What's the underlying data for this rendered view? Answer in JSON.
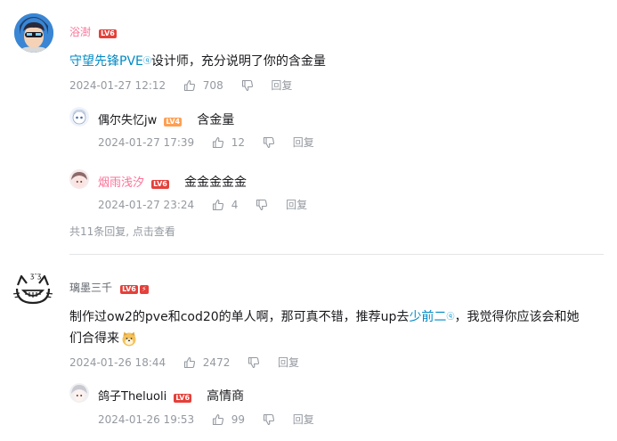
{
  "comments": [
    {
      "user": "浴澍",
      "level": "LV6",
      "content_link": "守望先锋PVE",
      "content_rest": "设计师，充分说明了你的含金量",
      "time": "2024-01-27 12:12",
      "likes": "708",
      "reply_label": "回复",
      "replies": [
        {
          "user": "偶尔失忆jw",
          "level": "LV4",
          "content": "含金量",
          "time": "2024-01-27 17:39",
          "likes": "12",
          "reply_label": "回复"
        },
        {
          "user": "烟雨浅汐",
          "level": "LV6",
          "content": "金金金金金",
          "time": "2024-01-27 23:24",
          "likes": "4",
          "reply_label": "回复"
        }
      ],
      "more_replies": "共11条回复, 点击查看"
    },
    {
      "user": "璃墨三千",
      "level": "LV6",
      "content_pre": "制作过ow2的pve和cod20的单人啊，那可真不错，推荐up去",
      "content_link": "少前二",
      "content_post": "，我觉得你应该会和她",
      "content_line2": "们合得来",
      "emoji": "doge-emoji",
      "time": "2024-01-26 18:44",
      "likes": "2472",
      "reply_label": "回复",
      "replies": [
        {
          "user": "鸽子Theluoli",
          "level": "LV6",
          "content": "高情商",
          "time": "2024-01-26 19:53",
          "likes": "99",
          "reply_label": "回复"
        }
      ]
    }
  ],
  "colors": {
    "name_pink": "#fb7299",
    "link_blue": "#008ac5",
    "meta_gray": "#9499a0"
  }
}
